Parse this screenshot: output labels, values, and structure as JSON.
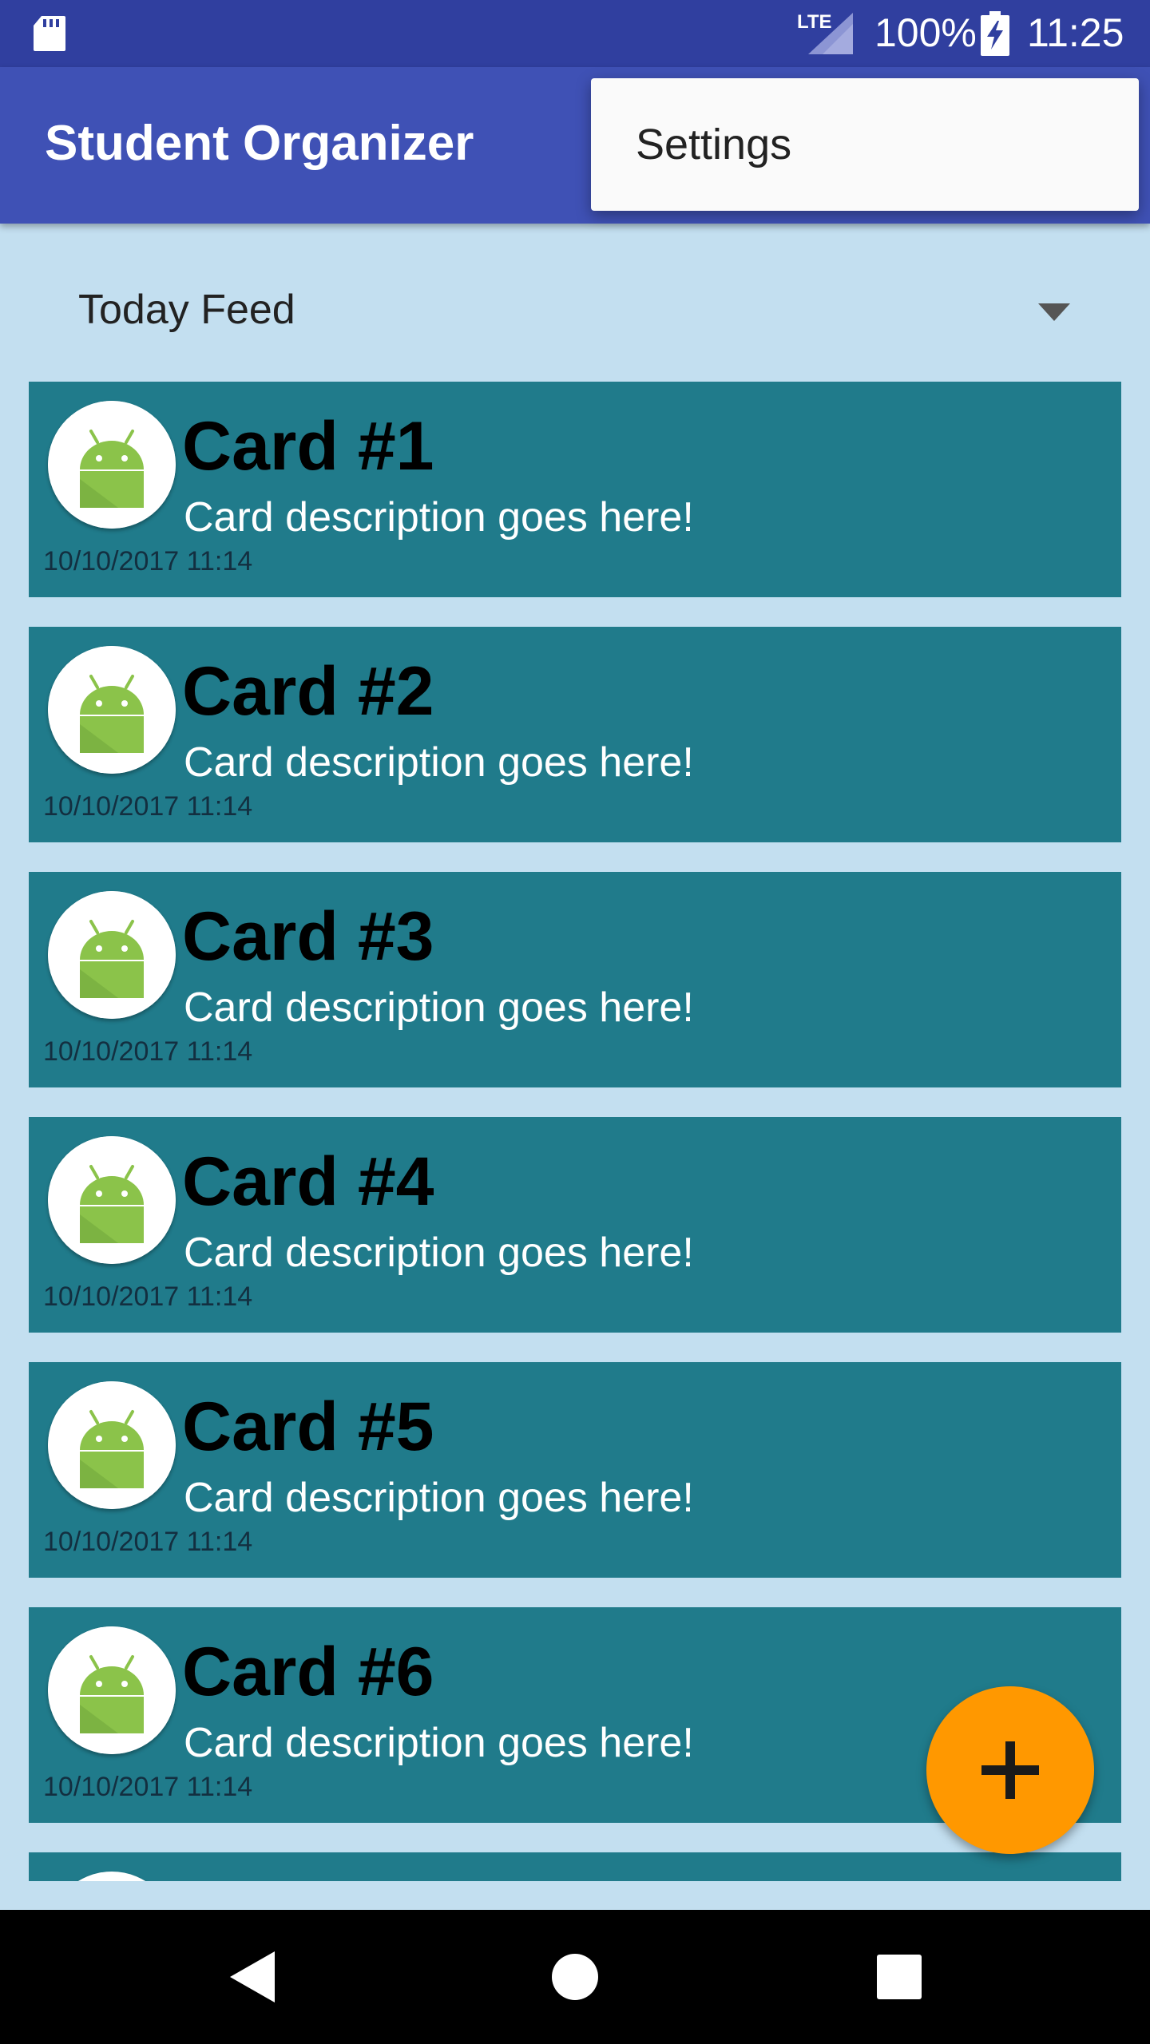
{
  "status_bar": {
    "network_label": "LTE",
    "battery_percent": "100%",
    "time": "11:25",
    "icons": [
      "sd-card-icon",
      "signal-icon",
      "battery-charging-icon"
    ]
  },
  "app_bar": {
    "title": "Student Organizer"
  },
  "overflow_menu": {
    "items": [
      {
        "label": "Settings"
      }
    ]
  },
  "feed_selector": {
    "selected": "Today Feed",
    "icon": "dropdown-arrow-icon"
  },
  "cards": [
    {
      "title": "Card #1",
      "description": "Card description goes here!",
      "timestamp": "10/10/2017 11:14"
    },
    {
      "title": "Card #2",
      "description": "Card description goes here!",
      "timestamp": "10/10/2017 11:14"
    },
    {
      "title": "Card #3",
      "description": "Card description goes here!",
      "timestamp": "10/10/2017 11:14"
    },
    {
      "title": "Card #4",
      "description": "Card description goes here!",
      "timestamp": "10/10/2017 11:14"
    },
    {
      "title": "Card #5",
      "description": "Card description goes here!",
      "timestamp": "10/10/2017 11:14"
    },
    {
      "title": "Card #6",
      "description": "Card description goes here!",
      "timestamp": "10/10/2017 11:14"
    }
  ],
  "fab": {
    "icon": "plus-icon"
  },
  "nav_bar": {
    "icons": [
      "back-icon",
      "home-icon",
      "recents-icon"
    ]
  },
  "colors": {
    "status_bar": "#303f9f",
    "app_bar": "#3f51b5",
    "background": "#c3dff0",
    "card": "#207b8b",
    "fab": "#ff9800"
  }
}
